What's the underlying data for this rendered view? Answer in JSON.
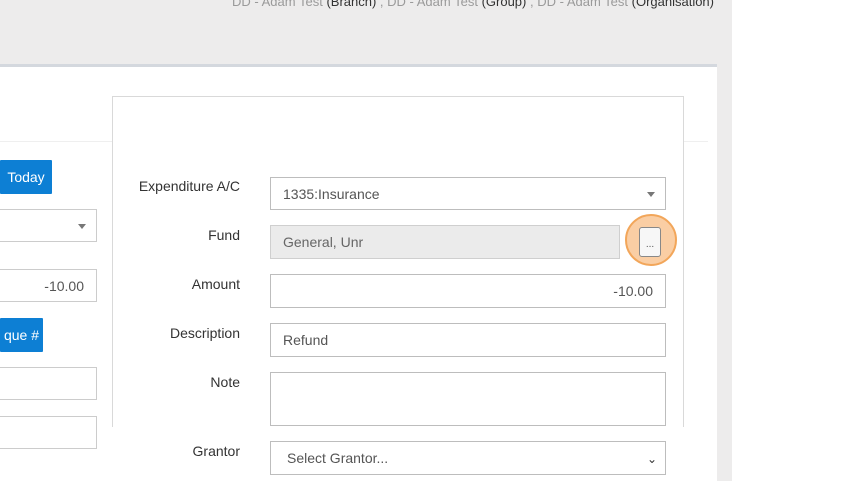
{
  "header": {
    "context": [
      {
        "name": "DD - Adam Test",
        "type": "(Branch)"
      },
      {
        "name": "DD - Adam Test",
        "type": "(Group)"
      },
      {
        "name": "DD - Adam Test",
        "type": "(Organisation)"
      }
    ],
    "separator": " , "
  },
  "left": {
    "today_label": "Today",
    "amount_value": "-10.00",
    "cheque_label": "que #"
  },
  "form": {
    "expenditure": {
      "label": "Expenditure A/C",
      "value": "1335:Insurance"
    },
    "fund": {
      "label": "Fund",
      "value": "General, Unr",
      "button": "..."
    },
    "amount": {
      "label": "Amount",
      "value": "-10.00"
    },
    "description": {
      "label": "Description",
      "value": "Refund"
    },
    "note": {
      "label": "Note",
      "value": ""
    },
    "grantor": {
      "label": "Grantor",
      "placeholder": "Select Grantor..."
    }
  },
  "colors": {
    "accent": "#0d7fd4",
    "highlight": "#f2a65a"
  }
}
